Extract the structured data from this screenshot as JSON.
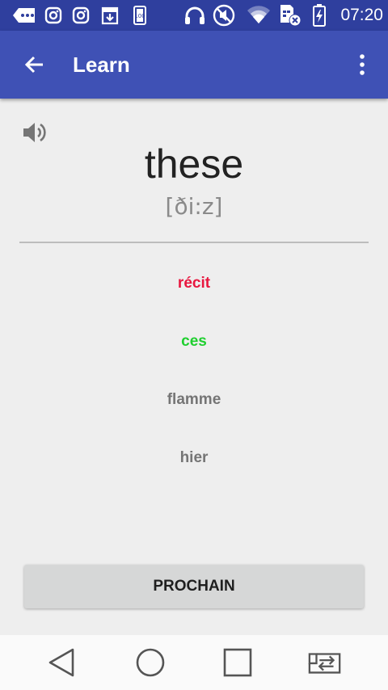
{
  "status_bar": {
    "time": "07:20",
    "icons": [
      "chat-more-icon",
      "instagram-icon",
      "instagram-icon",
      "download-icon",
      "battery-100-icon",
      "headphones-icon",
      "mute-icon",
      "wifi-icon",
      "sim-no-signal-icon",
      "battery-charging-icon"
    ]
  },
  "app_bar": {
    "title": "Learn",
    "back_icon": "arrow-left-icon",
    "menu_icon": "more-vertical-icon"
  },
  "card": {
    "speaker_icon": "speaker-icon",
    "word": "these",
    "phonetic": "[ði:z]"
  },
  "options": [
    {
      "label": "récit",
      "state": "wrong",
      "color": "#e8173f"
    },
    {
      "label": "ces",
      "state": "correct",
      "color": "#1fcf2f"
    },
    {
      "label": "flamme",
      "state": "neutral",
      "color": "#757575"
    },
    {
      "label": "hier",
      "state": "neutral",
      "color": "#757575"
    }
  ],
  "next_button": {
    "label": "PROCHAIN"
  },
  "nav_bar": {
    "icons": [
      "back-triangle-icon",
      "home-circle-icon",
      "recents-square-icon",
      "switch-app-icon"
    ]
  },
  "colors": {
    "primary": "#3f51b5",
    "primary_dark": "#2f3f9e",
    "background": "#eeeeee"
  }
}
